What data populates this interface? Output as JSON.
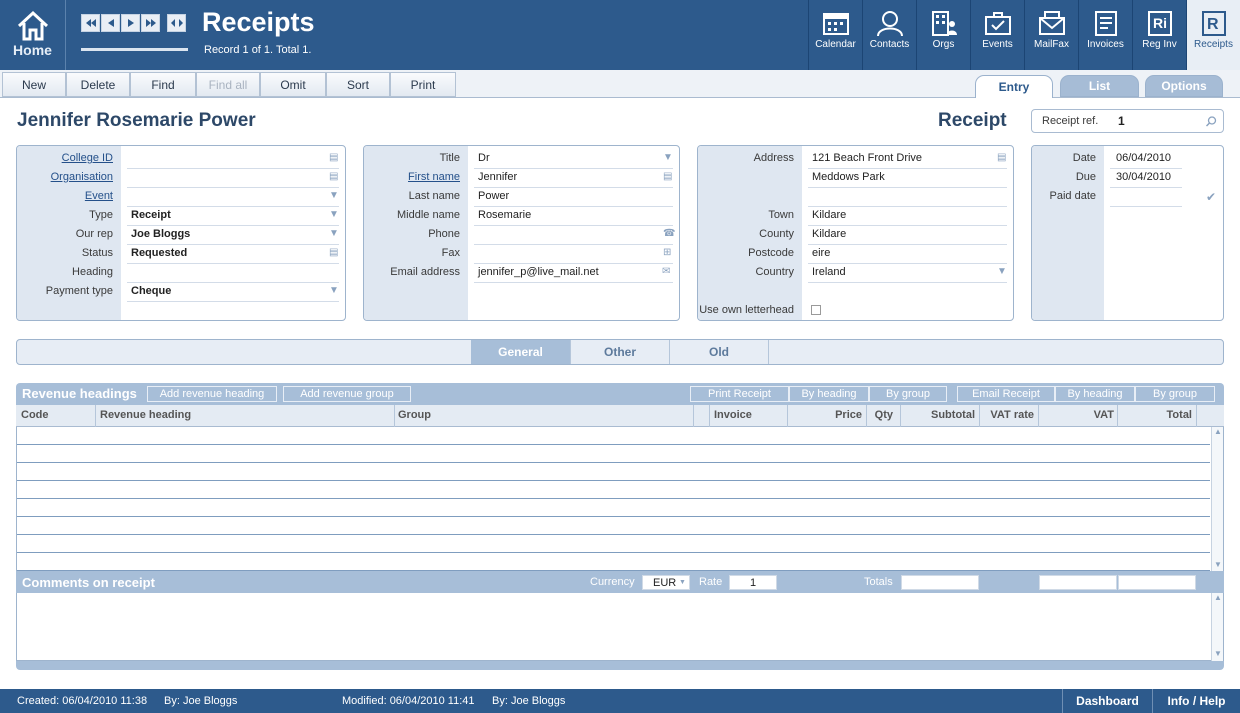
{
  "header": {
    "home_label": "Home",
    "title": "Receipts",
    "record_info": "Record 1 of 1. Total 1.",
    "modules": [
      {
        "label": "Calendar",
        "icon": "calendar-icon"
      },
      {
        "label": "Contacts",
        "icon": "person-icon"
      },
      {
        "label": "Orgs",
        "icon": "building-icon"
      },
      {
        "label": "Events",
        "icon": "briefcase-icon"
      },
      {
        "label": "MailFax",
        "icon": "mail-icon"
      },
      {
        "label": "Invoices",
        "icon": "invoice-icon"
      },
      {
        "label": "Reg Inv",
        "icon": "reg-inv-icon"
      },
      {
        "label": "Receipts",
        "icon": "receipt-icon"
      }
    ]
  },
  "toolbar": {
    "new": "New",
    "delete": "Delete",
    "find": "Find",
    "find_all": "Find all",
    "omit": "Omit",
    "sort": "Sort",
    "print": "Print"
  },
  "view_tabs": {
    "entry": "Entry",
    "list": "List",
    "options": "Options"
  },
  "record": {
    "person_name": "Jennifer Rosemarie Power",
    "doc_title": "Receipt",
    "receipt_ref_label": "Receipt ref.",
    "receipt_ref": "1"
  },
  "panel1": {
    "college_id_label": "College ID",
    "college_id": "",
    "organisation_label": "Organisation",
    "organisation": "",
    "event_label": "Event",
    "event": "",
    "type_label": "Type",
    "type": "Receipt",
    "our_rep_label": "Our rep",
    "our_rep": "Joe Bloggs",
    "status_label": "Status",
    "status": "Requested",
    "heading_label": "Heading",
    "heading": "",
    "payment_type_label": "Payment type",
    "payment_type": "Cheque"
  },
  "panel2": {
    "title_label": "Title",
    "title": "Dr",
    "first_name_label": "First name",
    "first_name": "Jennifer",
    "last_name_label": "Last name",
    "last_name": "Power",
    "middle_name_label": "Middle name",
    "middle_name": "Rosemarie",
    "phone_label": "Phone",
    "phone": "",
    "fax_label": "Fax",
    "fax": "",
    "email_label": "Email address",
    "email": "jennifer_p@live_mail.net"
  },
  "panel3": {
    "address_label": "Address",
    "address1": "121 Beach Front Drive",
    "address2": "Meddows Park",
    "town_label": "Town",
    "town": "Kildare",
    "county_label": "County",
    "county": "Kildare",
    "postcode_label": "Postcode",
    "postcode": "eire",
    "country_label": "Country",
    "country": "Ireland",
    "letterhead_label": "Use own letterhead",
    "letterhead_checked": false
  },
  "panel4": {
    "date_label": "Date",
    "date": "06/04/2010",
    "due_label": "Due",
    "due": "30/04/2010",
    "paid_label": "Paid date",
    "paid": ""
  },
  "sub_tabs": {
    "general": "General",
    "other": "Other",
    "old": "Old"
  },
  "revenue": {
    "title": "Revenue headings",
    "add_heading": "Add revenue heading",
    "add_group": "Add revenue group",
    "print_receipt": "Print Receipt",
    "by_heading": "By heading",
    "by_group": "By group",
    "email_receipt": "Email Receipt",
    "columns": {
      "code": "Code",
      "heading": "Revenue heading",
      "group": "Group",
      "invoice": "Invoice",
      "price": "Price",
      "qty": "Qty",
      "subtotal": "Subtotal",
      "vat_rate": "VAT rate",
      "vat": "VAT",
      "total": "Total"
    }
  },
  "comments": {
    "title": "Comments on receipt",
    "currency_label": "Currency",
    "currency": "EUR",
    "rate_label": "Rate",
    "rate": "1",
    "totals_label": "Totals"
  },
  "status": {
    "created": "Created: 06/04/2010  11:38",
    "created_by": "By: Joe Bloggs",
    "modified": "Modified: 06/04/2010  11:41",
    "modified_by": "By: Joe Bloggs",
    "dashboard": "Dashboard",
    "info_help": "Info / Help"
  },
  "colors": {
    "header_blue": "#2d5a8c",
    "panel_label_bg": "#dfe7f1",
    "section_bar": "#a7bed8"
  }
}
